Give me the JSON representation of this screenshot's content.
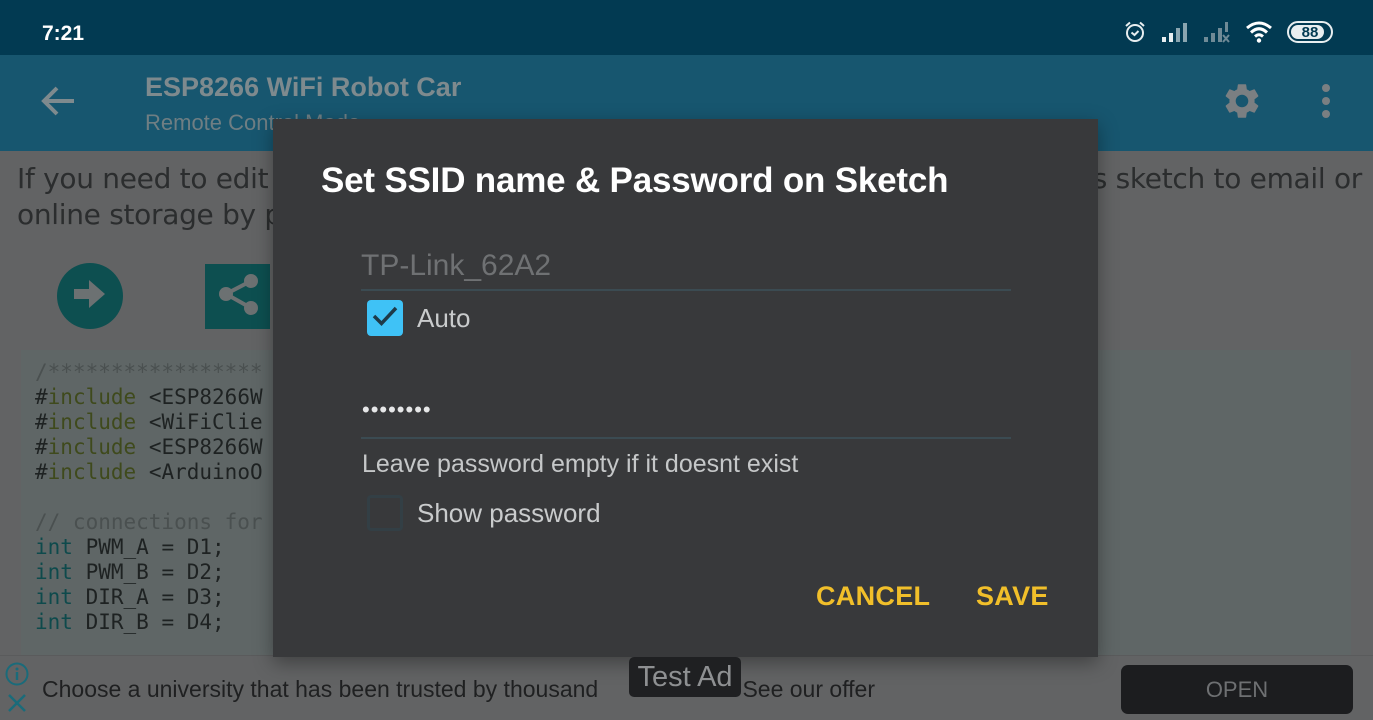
{
  "status_bar": {
    "time": "7:21",
    "battery": "88",
    "icons": [
      "alarm-icon",
      "signal-icon",
      "signal-no-service-icon",
      "wifi-icon",
      "battery-icon"
    ]
  },
  "app_bar": {
    "title": "ESP8266 WiFi Robot Car",
    "subtitle": "Remote Control Mode",
    "back_icon": "arrow-left-icon",
    "settings_icon": "gear-icon",
    "more_icon": "more-vertical-icon"
  },
  "content": {
    "intro_line1_left": "If you need to edit t",
    "intro_line1_right": "s sketch to email or",
    "intro_line2_left": "online storage by pr",
    "code_lines": [
      {
        "type": "comment",
        "text": "/*****************"
      },
      {
        "type": "include",
        "kw": "include",
        "rest": " <ESP8266W"
      },
      {
        "type": "include",
        "kw": "include",
        "rest": " <WiFiClie"
      },
      {
        "type": "include",
        "kw": "include",
        "rest": " <ESP8266W"
      },
      {
        "type": "include",
        "kw": "include",
        "rest": " <ArduinoO"
      },
      {
        "type": "blank",
        "text": ""
      },
      {
        "type": "comment",
        "text": "// connections for"
      },
      {
        "type": "int",
        "kw": "int",
        "rest": " PWM_A = D1;"
      },
      {
        "type": "int",
        "kw": "int",
        "rest": " PWM_B = D2;"
      },
      {
        "type": "int",
        "kw": "int",
        "rest": " DIR_A = D3;"
      },
      {
        "type": "int",
        "kw": "int",
        "rest": " DIR_B = D4;"
      }
    ]
  },
  "dialog": {
    "title": "Set SSID name & Password on Sketch",
    "ssid_value": "TP-Link_62A2",
    "auto_label": "Auto",
    "auto_checked": true,
    "password_masked": "••••••••",
    "password_hint": "Leave password empty if it doesnt exist",
    "show_password_label": "Show password",
    "show_password_checked": false,
    "cancel_label": "CANCEL",
    "save_label": "SAVE",
    "accent_color": "#f1bf2a",
    "checkbox_color": "#3fc2f6"
  },
  "ad": {
    "text_left": "Choose a university that has been trusted by thousand",
    "text_right": "ates. See our offer",
    "open_label": "OPEN",
    "test_ad_label": "Test Ad"
  }
}
